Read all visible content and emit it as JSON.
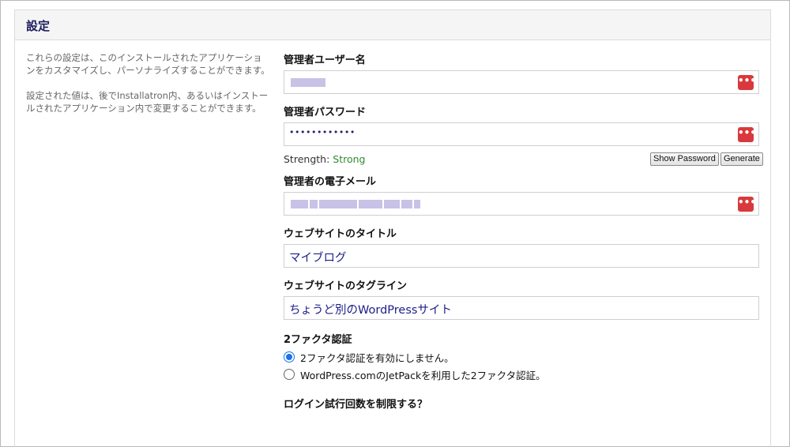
{
  "panel": {
    "title": "設定"
  },
  "description": {
    "p1": "これらの設定は、このインストールされたアプリケーションをカスタマイズし、パーソナライズすることができます。",
    "p2": "設定された値は、後でInstallatron内、あるいはインストールされたアプリケーション内で変更することができます。"
  },
  "admin_user": {
    "label": "管理者ユーザー名",
    "icon": "password-manager-icon"
  },
  "admin_password": {
    "label": "管理者パスワード",
    "value": "••••••••••••",
    "strength_label": "Strength:",
    "strength_value": "Strong",
    "show_password": "Show Password",
    "generate": "Generate",
    "icon": "password-manager-icon"
  },
  "admin_email": {
    "label": "管理者の電子メール",
    "icon": "password-manager-icon"
  },
  "site_title": {
    "label": "ウェブサイトのタイトル",
    "value": "マイブログ"
  },
  "site_tagline": {
    "label": "ウェブサイトのタグライン",
    "value": "ちょうど別のWordPressサイト"
  },
  "two_factor": {
    "label": "2ファクタ認証",
    "options": [
      {
        "label": "2ファクタ認証を有効にしません。",
        "checked": true
      },
      {
        "label": "WordPress.comのJetPackを利用した2ファクタ認証。",
        "checked": false
      }
    ]
  },
  "login_limit": {
    "label": "ログイン試行回数を制限する？"
  },
  "colors": {
    "accent": "#1a73e8",
    "key_button": "#d9393c",
    "strength_strong": "#2e8b2e"
  }
}
